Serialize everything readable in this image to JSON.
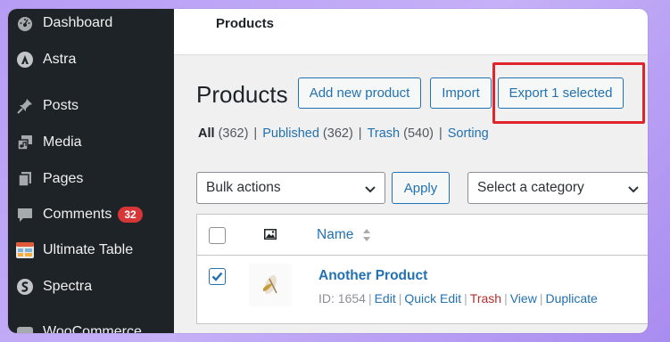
{
  "sidebar": {
    "items": [
      {
        "label": "Dashboard",
        "icon": "dashboard-icon"
      },
      {
        "label": "Astra",
        "icon": "astra-icon"
      },
      {
        "label": "Posts",
        "icon": "pin-icon"
      },
      {
        "label": "Media",
        "icon": "media-icon"
      },
      {
        "label": "Pages",
        "icon": "pages-icon"
      },
      {
        "label": "Comments",
        "icon": "comment-icon",
        "badge": "32"
      },
      {
        "label": "Ultimate Table",
        "icon": "table-icon"
      },
      {
        "label": "Spectra",
        "icon": "spectra-icon"
      },
      {
        "label": "WooCommerce",
        "icon": "woo-icon"
      }
    ]
  },
  "topbar": {
    "title": "Products"
  },
  "main": {
    "heading": "Products",
    "add_new": "Add new product",
    "import": "Import",
    "export": "Export 1 selected",
    "views": {
      "all": "All",
      "all_count": "(362)",
      "published": "Published",
      "published_count": "(362)",
      "trash": "Trash",
      "trash_count": "(540)",
      "sorting": "Sorting",
      "sep": "|"
    },
    "bulk_actions": "Bulk actions",
    "apply": "Apply",
    "category": "Select a category",
    "columns": {
      "name": "Name"
    },
    "rows": [
      {
        "title": "Another Product",
        "id_text": "ID: 1654",
        "checked": true,
        "actions": {
          "edit": "Edit",
          "quick_edit": "Quick Edit",
          "trash": "Trash",
          "view": "View",
          "duplicate": "Duplicate"
        }
      }
    ]
  },
  "colors": {
    "accent": "#2271b1",
    "sidebar_bg": "#1d2327",
    "highlight": "#e0242b",
    "badge": "#d63638"
  }
}
